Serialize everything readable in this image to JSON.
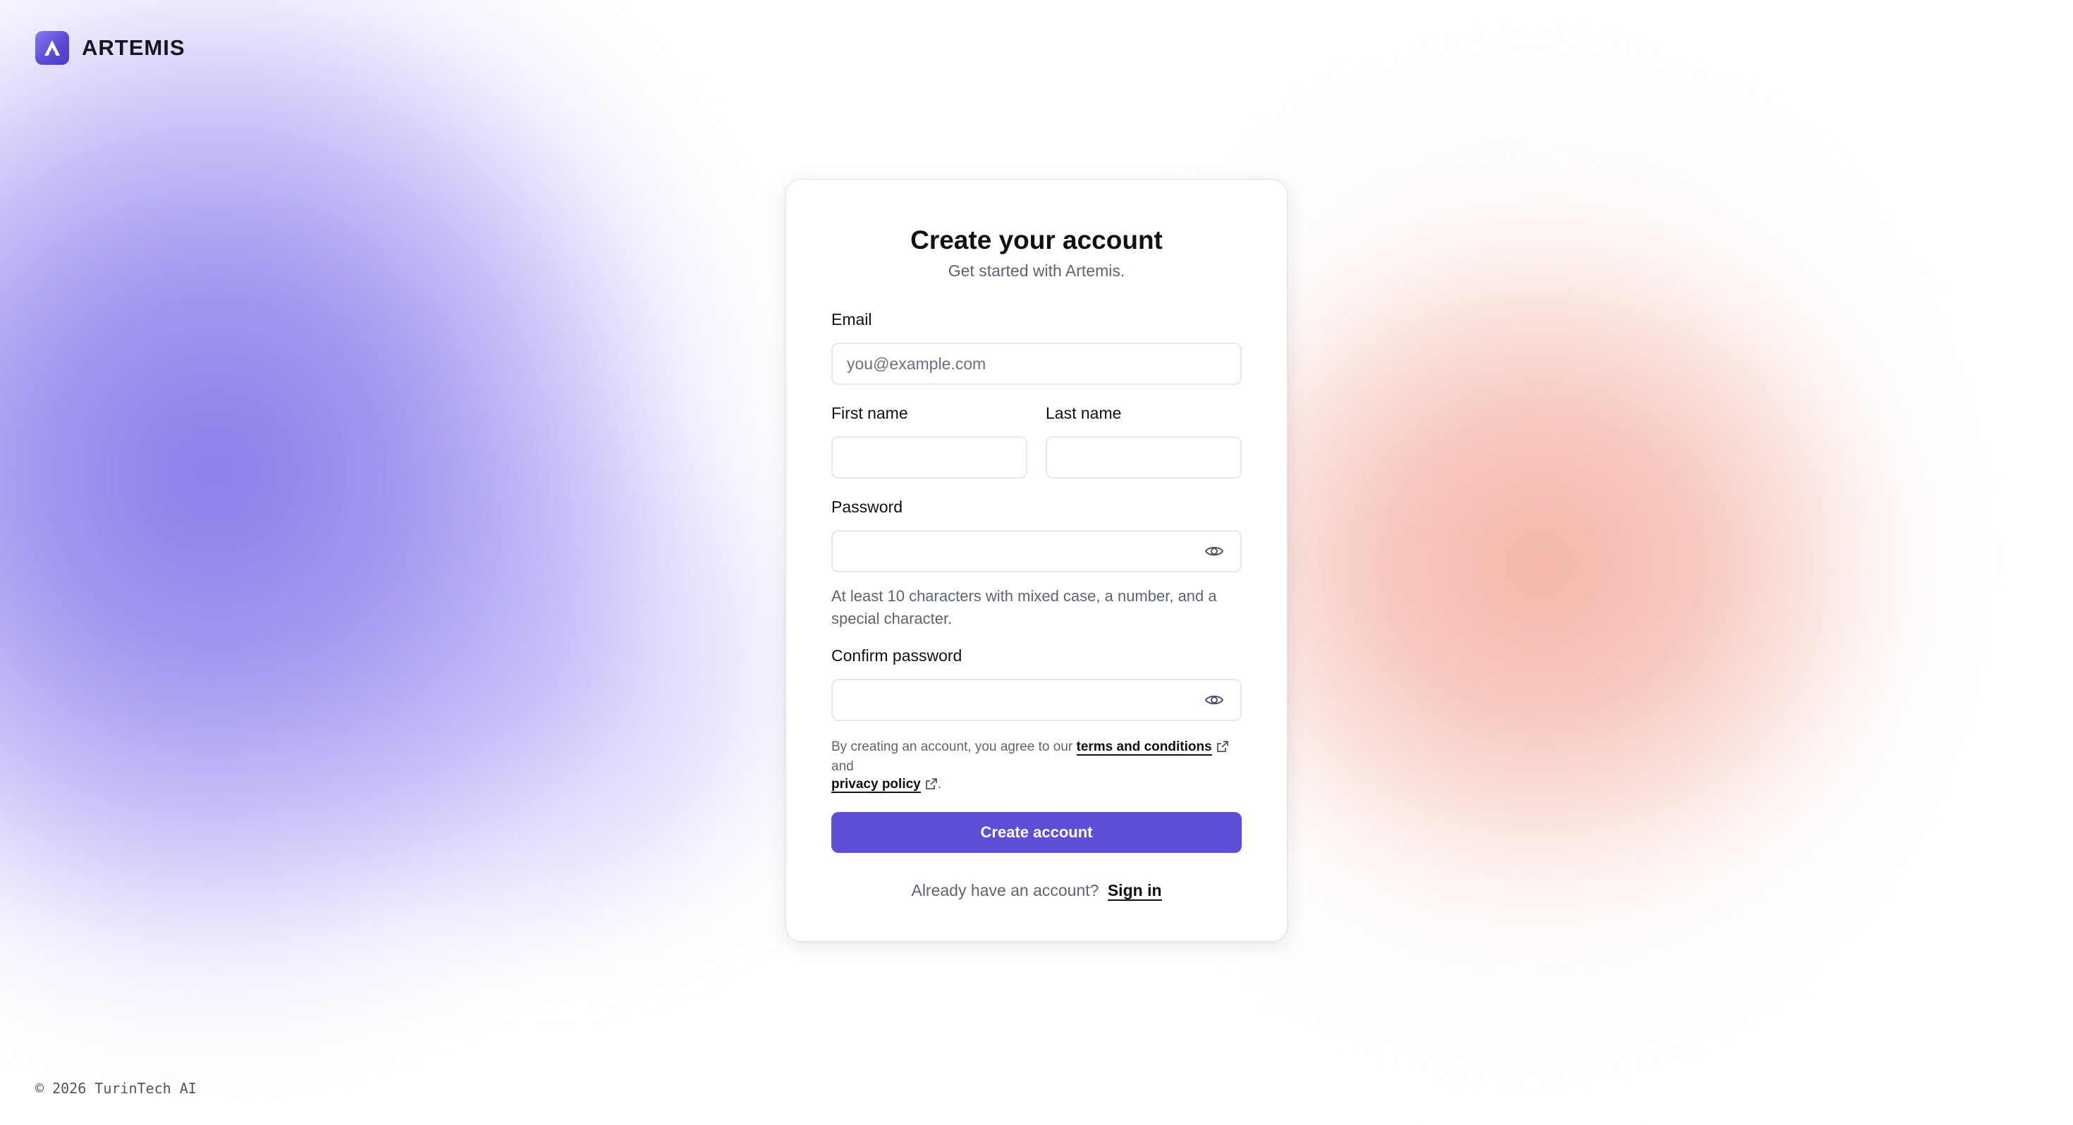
{
  "brand": {
    "name": "ARTEMIS",
    "logo_icon": "artemis-logo-icon",
    "logo_color": "#5b4ad8"
  },
  "form": {
    "title": "Create your account",
    "subtitle": "Get started with Artemis.",
    "email": {
      "label": "Email",
      "placeholder": "you@example.com",
      "value": ""
    },
    "first_name": {
      "label": "First name",
      "value": ""
    },
    "last_name": {
      "label": "Last name",
      "value": ""
    },
    "password": {
      "label": "Password",
      "value": "",
      "toggle_icon": "eye-icon",
      "hint": "At least 10 characters with mixed case, a number, and a special character."
    },
    "confirm_password": {
      "label": "Confirm password",
      "value": "",
      "toggle_icon": "eye-icon"
    },
    "terms": {
      "prefix": "By creating an account, you agree to our",
      "terms_link": "terms and conditions",
      "joiner": "and",
      "privacy_link": "privacy policy",
      "suffix": ".",
      "link_icon": "external-link-icon"
    },
    "submit_label": "Create account",
    "signin": {
      "prompt": "Already have an account?",
      "link": "Sign in"
    }
  },
  "footer": {
    "copyright": "© 2026 TurinTech AI"
  },
  "colors": {
    "accent": "#5d4fd6",
    "background_left_blob": "#8476e8",
    "background_right_blob": "#f4b2a6"
  }
}
